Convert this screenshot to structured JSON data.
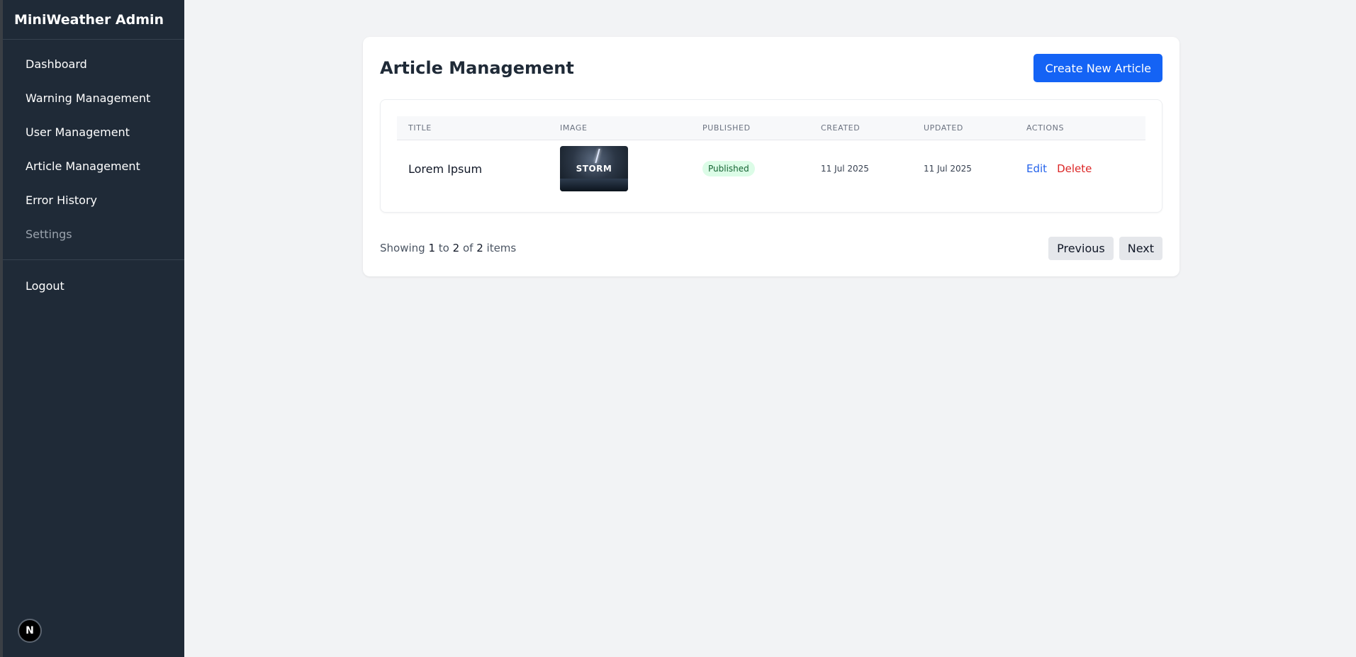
{
  "sidebar": {
    "brand": "MiniWeather Admin",
    "items": [
      {
        "label": "Dashboard"
      },
      {
        "label": "Warning Management"
      },
      {
        "label": "User Management"
      },
      {
        "label": "Article Management"
      },
      {
        "label": "Error History"
      },
      {
        "label": "Settings"
      }
    ],
    "logout": "Logout",
    "badge": "N"
  },
  "main": {
    "title": "Article Management",
    "create_label": "Create New Article",
    "table": {
      "headers": [
        "TITLE",
        "IMAGE",
        "PUBLISHED",
        "CREATED",
        "UPDATED",
        "ACTIONS"
      ],
      "rows": [
        {
          "title": "Lorem Ipsum",
          "image_text": "STORM",
          "status": "Published",
          "created": "11 Jul 2025",
          "updated": "11 Jul 2025",
          "edit": "Edit",
          "delete": "Delete"
        }
      ]
    },
    "pagination": {
      "prefix": "Showing",
      "from": "1",
      "to_word": "to",
      "to": "2",
      "of_word": "of",
      "total": "2",
      "suffix": "items",
      "previous": "Previous",
      "next": "Next"
    }
  },
  "colors": {
    "sidebar_bg": "#1f2a37",
    "accent": "#1463f5",
    "danger": "#dc2626",
    "success_bg": "#dcfce7"
  }
}
